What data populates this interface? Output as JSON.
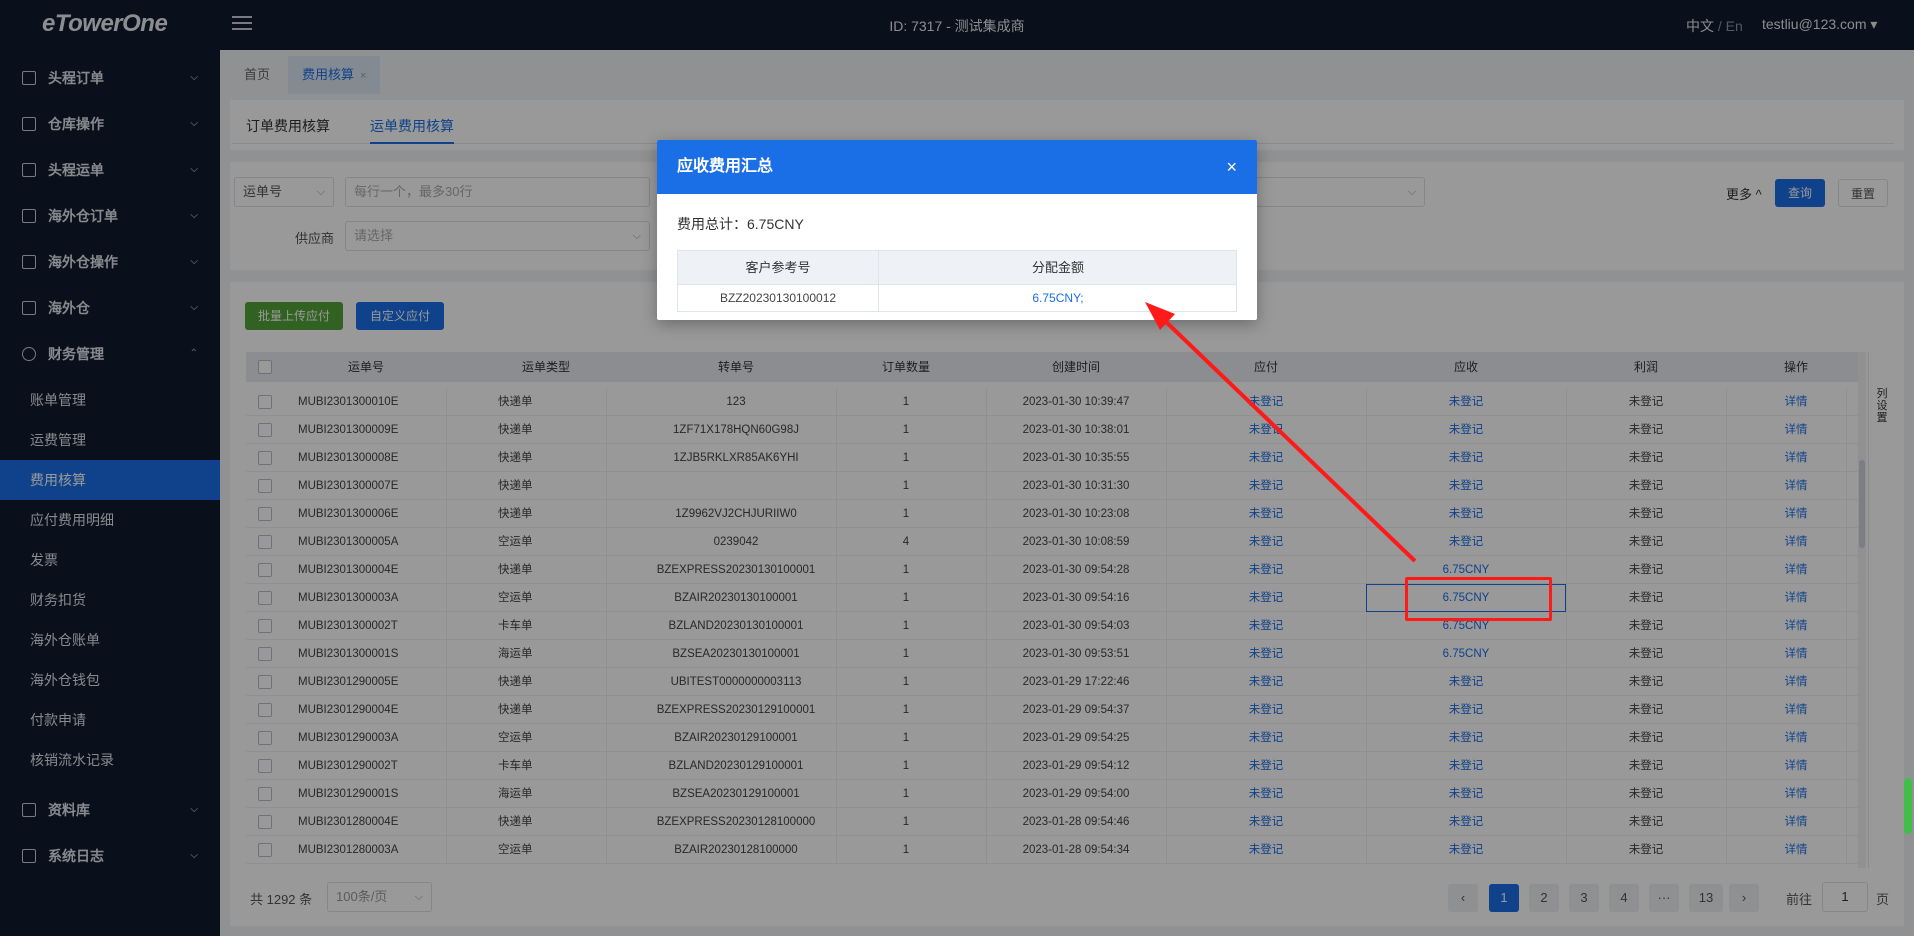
{
  "header": {
    "logo": "eTowerOne",
    "center_title": "ID: 7317 - 测试集成商",
    "lang_zh": "中文",
    "lang_sep": "/",
    "lang_en": "En",
    "user": "testliu@123.com ▾"
  },
  "sidebar": {
    "groups": [
      {
        "label": "头程订单"
      },
      {
        "label": "仓库操作"
      },
      {
        "label": "头程运单"
      },
      {
        "label": "海外仓订单"
      },
      {
        "label": "海外仓操作"
      },
      {
        "label": "海外仓"
      },
      {
        "label": "财务管理"
      }
    ],
    "finance_items": [
      {
        "label": "账单管理"
      },
      {
        "label": "运费管理"
      },
      {
        "label": "费用核算"
      },
      {
        "label": "应付费用明细"
      },
      {
        "label": "发票"
      },
      {
        "label": "财务扣货"
      },
      {
        "label": "海外仓账单"
      },
      {
        "label": "海外仓钱包"
      },
      {
        "label": "付款申请"
      },
      {
        "label": "核销流水记录"
      }
    ],
    "bottom_groups": [
      {
        "label": "资料库"
      },
      {
        "label": "系统日志"
      }
    ]
  },
  "tabs": {
    "home": "首页",
    "current": "费用核算",
    "close": "×"
  },
  "subtabs": {
    "order": "订单费用核算",
    "waybill": "运单费用核算"
  },
  "filters": {
    "field_select": "运单号",
    "search_placeholder": "每行一个，最多30行",
    "supplier_label": "供应商",
    "supplier_placeholder": "请选择",
    "more": "更多 ^",
    "query": "查询",
    "reset": "重置"
  },
  "actions": {
    "bulk_upload": "批量上传应付",
    "custom_payable": "自定义应付"
  },
  "table": {
    "columns": [
      "运单号",
      "运单类型",
      "转单号",
      "订单数量",
      "创建时间",
      "应付",
      "应收",
      "利润",
      "操作"
    ],
    "settings_label": "列设置",
    "rows": [
      {
        "no": "MUBI2301300010E",
        "type": "快递单",
        "transfer": "123",
        "qty": "1",
        "time": "2023-01-30 10:39:47",
        "payable": "未登记",
        "receivable": "未登记",
        "profit": "未登记",
        "op": "详情"
      },
      {
        "no": "MUBI2301300009E",
        "type": "快递单",
        "transfer": "1ZF71X178HQN60G98J",
        "qty": "1",
        "time": "2023-01-30 10:38:01",
        "payable": "未登记",
        "receivable": "未登记",
        "profit": "未登记",
        "op": "详情"
      },
      {
        "no": "MUBI2301300008E",
        "type": "快递单",
        "transfer": "1ZJB5RKLXR85AK6YHI",
        "qty": "1",
        "time": "2023-01-30 10:35:55",
        "payable": "未登记",
        "receivable": "未登记",
        "profit": "未登记",
        "op": "详情"
      },
      {
        "no": "MUBI2301300007E",
        "type": "快递单",
        "transfer": "",
        "qty": "1",
        "time": "2023-01-30 10:31:30",
        "payable": "未登记",
        "receivable": "未登记",
        "profit": "未登记",
        "op": "详情"
      },
      {
        "no": "MUBI2301300006E",
        "type": "快递单",
        "transfer": "1Z9962VJ2CHJURIIW0",
        "qty": "1",
        "time": "2023-01-30 10:23:08",
        "payable": "未登记",
        "receivable": "未登记",
        "profit": "未登记",
        "op": "详情"
      },
      {
        "no": "MUBI2301300005A",
        "type": "空运单",
        "transfer": "0239042",
        "qty": "4",
        "time": "2023-01-30 10:08:59",
        "payable": "未登记",
        "receivable": "未登记",
        "profit": "未登记",
        "op": "详情"
      },
      {
        "no": "MUBI2301300004E",
        "type": "快递单",
        "transfer": "BZEXPRESS20230130100001",
        "qty": "1",
        "time": "2023-01-30 09:54:28",
        "payable": "未登记",
        "receivable": "6.75CNY",
        "profit": "未登记",
        "op": "详情"
      },
      {
        "no": "MUBI2301300003A",
        "type": "空运单",
        "transfer": "BZAIR20230130100001",
        "qty": "1",
        "time": "2023-01-30 09:54:16",
        "payable": "未登记",
        "receivable": "6.75CNY",
        "profit": "未登记",
        "op": "详情"
      },
      {
        "no": "MUBI2301300002T",
        "type": "卡车单",
        "transfer": "BZLAND20230130100001",
        "qty": "1",
        "time": "2023-01-30 09:54:03",
        "payable": "未登记",
        "receivable": "6.75CNY",
        "profit": "未登记",
        "op": "详情"
      },
      {
        "no": "MUBI2301300001S",
        "type": "海运单",
        "transfer": "BZSEA20230130100001",
        "qty": "1",
        "time": "2023-01-30 09:53:51",
        "payable": "未登记",
        "receivable": "6.75CNY",
        "profit": "未登记",
        "op": "详情"
      },
      {
        "no": "MUBI2301290005E",
        "type": "快递单",
        "transfer": "UBITEST0000000003113",
        "qty": "1",
        "time": "2023-01-29 17:22:46",
        "payable": "未登记",
        "receivable": "未登记",
        "profit": "未登记",
        "op": "详情"
      },
      {
        "no": "MUBI2301290004E",
        "type": "快递单",
        "transfer": "BZEXPRESS20230129100001",
        "qty": "1",
        "time": "2023-01-29 09:54:37",
        "payable": "未登记",
        "receivable": "未登记",
        "profit": "未登记",
        "op": "详情"
      },
      {
        "no": "MUBI2301290003A",
        "type": "空运单",
        "transfer": "BZAIR20230129100001",
        "qty": "1",
        "time": "2023-01-29 09:54:25",
        "payable": "未登记",
        "receivable": "未登记",
        "profit": "未登记",
        "op": "详情"
      },
      {
        "no": "MUBI2301290002T",
        "type": "卡车单",
        "transfer": "BZLAND20230129100001",
        "qty": "1",
        "time": "2023-01-29 09:54:12",
        "payable": "未登记",
        "receivable": "未登记",
        "profit": "未登记",
        "op": "详情"
      },
      {
        "no": "MUBI2301290001S",
        "type": "海运单",
        "transfer": "BZSEA20230129100001",
        "qty": "1",
        "time": "2023-01-29 09:54:00",
        "payable": "未登记",
        "receivable": "未登记",
        "profit": "未登记",
        "op": "详情"
      },
      {
        "no": "MUBI2301280004E",
        "type": "快递单",
        "transfer": "BZEXPRESS20230128100000",
        "qty": "1",
        "time": "2023-01-28 09:54:46",
        "payable": "未登记",
        "receivable": "未登记",
        "profit": "未登记",
        "op": "详情"
      },
      {
        "no": "MUBI2301280003A",
        "type": "空运单",
        "transfer": "BZAIR20230128100000",
        "qty": "1",
        "time": "2023-01-28 09:54:34",
        "payable": "未登记",
        "receivable": "未登记",
        "profit": "未登记",
        "op": "详情"
      }
    ]
  },
  "pagination": {
    "total": "共 1292 条",
    "page_size": "100条/页",
    "prev": "‹",
    "pages": [
      "1",
      "2",
      "3",
      "4",
      "···",
      "13"
    ],
    "next": "›",
    "goto_label": "前往",
    "goto_value": "1",
    "goto_suffix": "页"
  },
  "modal": {
    "title": "应收费用汇总",
    "close": "×",
    "total": "费用总计：6.75CNY",
    "columns": [
      "客户参考号",
      "分配金额"
    ],
    "rows": [
      {
        "ref": "BZZ20230130100012",
        "amount": "6.75CNY;"
      }
    ]
  },
  "colors": {
    "primary": "#1a6ee6",
    "sidebar_bg": "#0f1b2d",
    "annotation_red": "#ff1a1a",
    "green_button": "#52a33a"
  }
}
